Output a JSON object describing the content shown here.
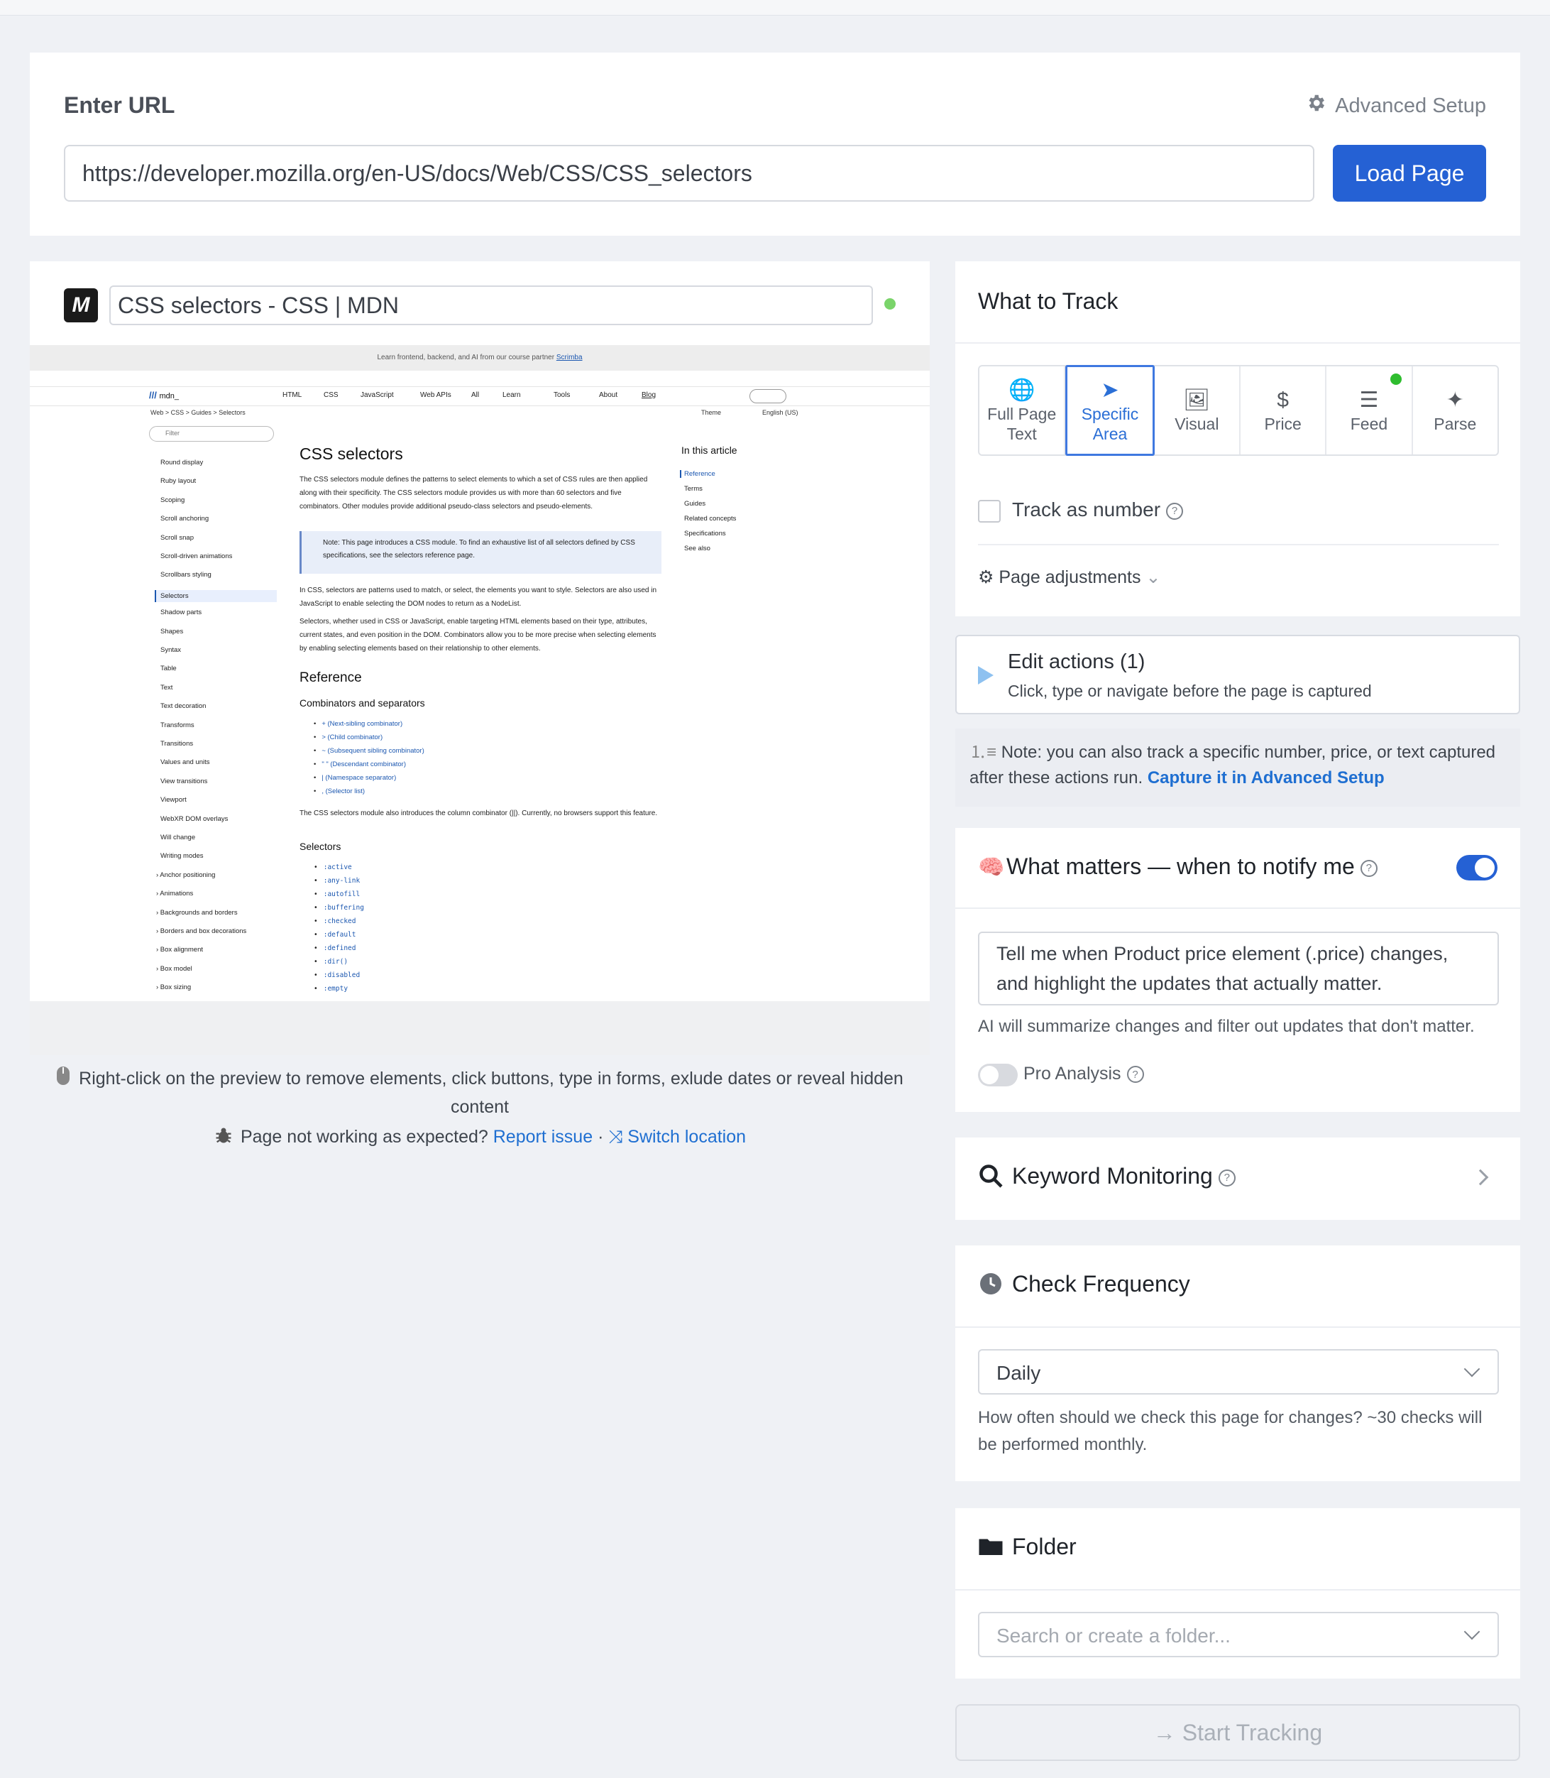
{
  "url_section": {
    "title": "Enter URL",
    "advanced_setup": "Advanced Setup",
    "url_value": "https://developer.mozilla.org/en-US/docs/Web/CSS/CSS_selectors",
    "load_button": "Load Page"
  },
  "preview": {
    "logo_text": "M",
    "page_title": "CSS selectors - CSS | MDN",
    "status_color": "#7ad46a",
    "site": {
      "banner_text": "Learn frontend, backend, and AI from our course partner",
      "banner_link": "Scrimba",
      "brand": "mdn_",
      "nav": [
        "HTML",
        "CSS",
        "JavaScript",
        "Web APIs",
        "All",
        "Learn",
        "Tools",
        "About",
        "Blog"
      ],
      "breadcrumb": [
        "Web",
        "CSS",
        "Guides",
        "Selectors"
      ],
      "theme": "Theme",
      "language": "English (US)",
      "filter_placeholder": "Filter",
      "sidebar": [
        "Round display",
        "Ruby layout",
        "Scoping",
        "Scroll anchoring",
        "Scroll snap",
        "Scroll-driven animations",
        "Scrollbars styling",
        "Selectors",
        "Shadow parts",
        "Shapes",
        "Syntax",
        "Table",
        "Text",
        "Text decoration",
        "Transforms",
        "Transitions",
        "Values and units",
        "View transitions",
        "Viewport",
        "WebXR DOM overlays",
        "Will change",
        "Writing modes",
        "Anchor positioning",
        "Animations",
        "Backgrounds and borders",
        "Borders and box decorations",
        "Box alignment",
        "Box model",
        "Box sizing"
      ],
      "sidebar_active": "Selectors",
      "heading": "CSS selectors",
      "intro": "The CSS selectors module defines the patterns to select elements to which a set of CSS rules are then applied along with their specificity. The CSS selectors module provides us with more than 60 selectors and five combinators. Other modules provide additional pseudo-class selectors and pseudo-elements.",
      "note": "Note: This page introduces a CSS module. To find an exhaustive list of all selectors defined by CSS specifications, see the selectors reference page.",
      "para1": "In CSS, selectors are patterns used to match, or select, the elements you want to style. Selectors are also used in JavaScript to enable selecting the DOM nodes to return as a NodeList.",
      "para2": "Selectors, whether used in CSS or JavaScript, enable targeting HTML elements based on their type, attributes, current states, and even position in the DOM. Combinators allow you to be more precise when selecting elements by enabling selecting elements based on their relationship to other elements.",
      "reference_heading": "Reference",
      "combinators_heading": "Combinators and separators",
      "combinators": [
        "+ (Next-sibling combinator)",
        "> (Child combinator)",
        "~ (Subsequent sibling combinator)",
        "\" \" (Descendant combinator)",
        "| (Namespace separator)",
        ", (Selector list)"
      ],
      "column_note": "The CSS selectors module also introduces the column combinator (||). Currently, no browsers support this feature.",
      "selectors_heading": "Selectors",
      "selectors": [
        ":active",
        ":any-link",
        ":autofill",
        ":buffering",
        ":checked",
        ":default",
        ":defined",
        ":dir()",
        ":disabled",
        ":empty"
      ],
      "toc_title": "In this article",
      "toc": [
        "Reference",
        "Terms",
        "Guides",
        "Related concepts",
        "Specifications",
        "See also"
      ]
    },
    "hint": "Right-click on the preview to remove elements, click buttons, type in forms, exlude dates or reveal hidden content",
    "report_prefix": "Page not working as expected?",
    "report_link": "Report issue",
    "separator": "·",
    "switch_link": "Switch location"
  },
  "track": {
    "title": "What to Track",
    "tabs": [
      {
        "label1": "Full Page",
        "label2": "Text",
        "icon": "globe-icon",
        "glyph": "🌐"
      },
      {
        "label1": "Specific",
        "label2": "Area",
        "icon": "pointer-icon",
        "glyph": "➤"
      },
      {
        "label1": "Visual",
        "label2": "",
        "icon": "image-icon",
        "glyph": "🖼"
      },
      {
        "label1": "Price",
        "label2": "",
        "icon": "dollar-icon",
        "glyph": "$"
      },
      {
        "label1": "Feed",
        "label2": "",
        "icon": "list-icon",
        "glyph": "☰"
      },
      {
        "label1": "Parse",
        "label2": "",
        "icon": "sparkle-icon",
        "glyph": "✦"
      }
    ],
    "active_tab": "Specific Area",
    "track_number": "Track as number",
    "page_adjustments": "Page adjustments"
  },
  "edit_actions": {
    "title": "Edit actions (1)",
    "subtitle": "Click, type or navigate before the page is captured"
  },
  "note": {
    "text": "Note: you can also track a specific number, price, or text captured after these actions run.",
    "link": "Capture it in Advanced Setup"
  },
  "matters": {
    "title": "What matters — when to notify me",
    "enabled": true,
    "prompt": "Tell me when Product price element (.price) changes, and highlight the updates that actually matter.",
    "ai_note": "AI will summarize changes and filter out updates that don't matter.",
    "pro_label": "Pro Analysis",
    "pro_enabled": false
  },
  "keyword": {
    "title": "Keyword Monitoring"
  },
  "frequency": {
    "title": "Check Frequency",
    "value": "Daily",
    "help": "How often should we check this page for changes? ~30 checks will be performed monthly."
  },
  "folder": {
    "title": "Folder",
    "placeholder": "Search or create a folder..."
  },
  "start": {
    "label": "Start Tracking"
  },
  "colors": {
    "accent": "#2561d4",
    "link": "#1f6fd1",
    "status_green": "#7ad46a"
  }
}
